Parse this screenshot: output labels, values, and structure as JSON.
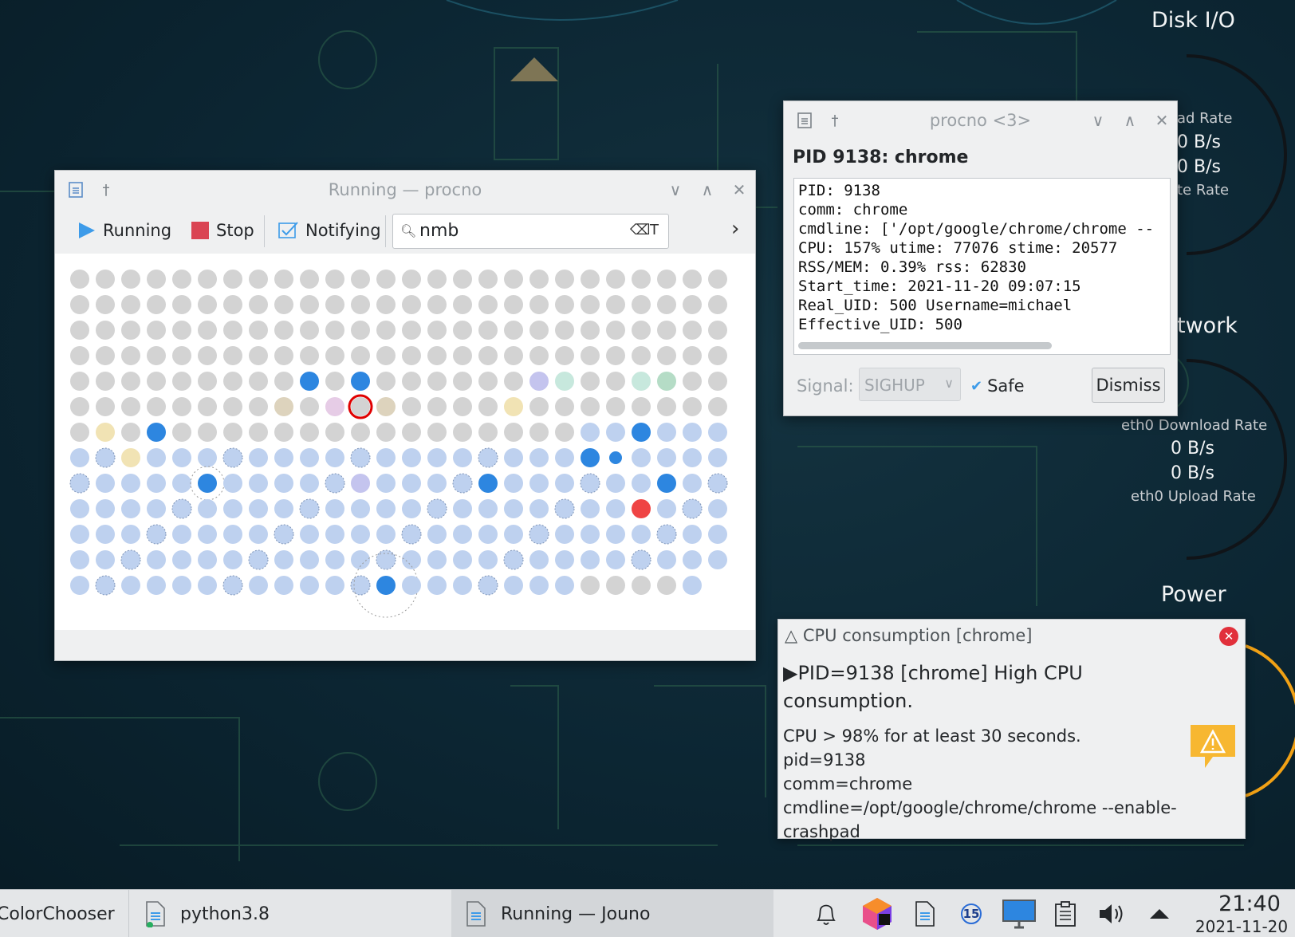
{
  "desktop": {
    "widgets": {
      "disk_title": "Disk I/O",
      "read_rate_label": "ad Rate",
      "read_value": "0 B/s",
      "write_value": "0 B/s",
      "write_rate_label": "te Rate",
      "network_title": "twork",
      "download_label": "eth0 Download Rate",
      "download_value": "0 B/s",
      "upload_value": "0 B/s",
      "upload_label": "eth0 Upload Rate",
      "power_title": "Power"
    }
  },
  "main_window": {
    "title": "Running — procno",
    "toolbar": {
      "running_label": "Running",
      "stop_label": "Stop",
      "notifying_label": "Notifying",
      "search_value": "nmb"
    }
  },
  "detail_window": {
    "title": "procno <3>",
    "heading": "PID 9138: chrome",
    "lines": [
      "PID: 9138",
      "comm: chrome",
      "cmdline: ['/opt/google/chrome/chrome --",
      "CPU: 157% utime: 77076 stime: 20577",
      "RSS/MEM:  0.39% rss: 62830",
      "Start_time: 2021-11-20 09:07:15",
      "Real_UID: 500 Username=michael",
      "Effective_UID: 500"
    ],
    "signal_label": "Signal:",
    "signal_value": "SIGHUP",
    "safe_label": "Safe",
    "safe_checked": true,
    "dismiss_label": "Dismiss"
  },
  "notification": {
    "title": "CPU consumption [chrome]",
    "summary": "▶PID=9138 [chrome] High CPU consumption.",
    "lines": [
      "CPU > 98% for at least 30 seconds.",
      "pid=9138",
      "comm=chrome",
      "cmdline=/opt/google/chrome/chrome --enable-",
      "crashpad"
    ]
  },
  "taskbar": {
    "tasks": [
      "ColorChooser",
      "python3.8",
      "Running — Jouno"
    ],
    "tray_badge": "15",
    "clock_time": "21:40",
    "clock_date": "2021-11-20"
  },
  "colors": {
    "inactive": "#d3d3d3",
    "idle": "#bed1ef",
    "active": "#2d86e0",
    "alert": "#ef4444",
    "tan": "#ddd3bd",
    "cream": "#f1e3b4",
    "pink": "#e6cce6",
    "lavender": "#c4c4ee",
    "mint": "#c7e8dd",
    "green": "#b5dcc6"
  }
}
